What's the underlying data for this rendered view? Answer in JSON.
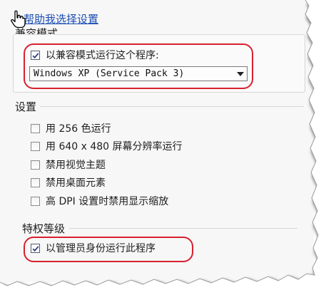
{
  "help_link": "帮助我选择设置",
  "compat": {
    "title": "兼容模式",
    "checkbox_label": "以兼容模式运行这个程序:",
    "checked": true,
    "selected_os": "Windows XP (Service Pack 3)"
  },
  "settings": {
    "title": "设置",
    "items": [
      {
        "label": "用 256 色运行",
        "checked": false
      },
      {
        "label": "用 640 x 480 屏幕分辨率运行",
        "checked": false
      },
      {
        "label": "禁用视觉主题",
        "checked": false
      },
      {
        "label": "禁用桌面元素",
        "checked": false
      },
      {
        "label": "高 DPI 设置时禁用显示缩放",
        "checked": false
      }
    ]
  },
  "privilege": {
    "title": "特权等级",
    "checkbox_label": "以管理员身份运行此程序",
    "checked": true
  },
  "colors": {
    "highlight": "#d8202e",
    "link": "#1a4db3",
    "panel_bg": "#f7f7f7"
  },
  "icons": {
    "cursor": "hand-pointer-icon",
    "checkmark": "checkmark-icon",
    "dropdown": "chevron-down-icon"
  }
}
